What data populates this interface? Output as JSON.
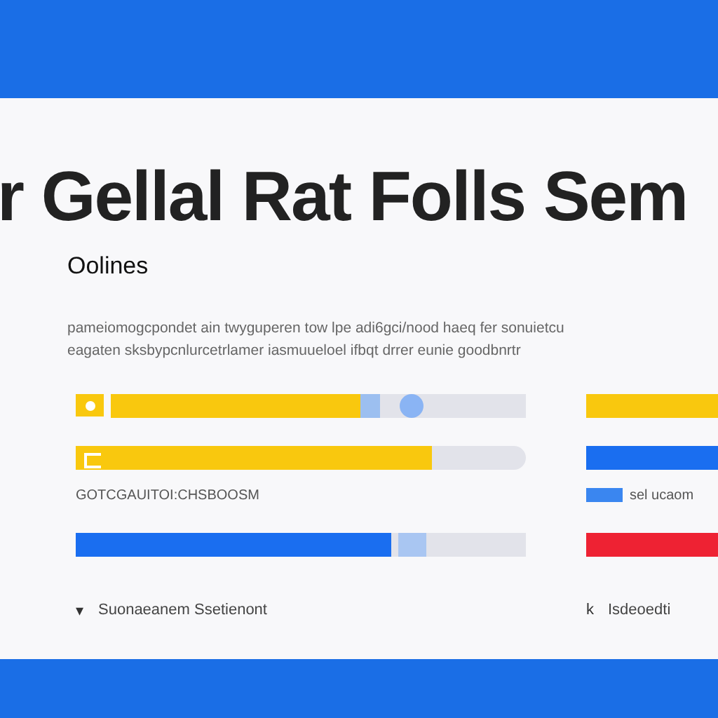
{
  "heading": "r Gellal Rat Folls Sem",
  "subtitle": "Oolines",
  "description": [
    "pameiomogcpondet ain twyguperen tow lpe adi6gci/nood haeq fer sonuietcu",
    "eagaten sksbypcnlurcetrlamer iasmuueloel ifbqt drrer eunie goodbnrtr"
  ],
  "left": [
    {
      "kind": "slider",
      "color": "#f9c80e",
      "level": 0.6
    },
    {
      "kind": "bar",
      "color": "#f9c80e",
      "level": 0.79
    },
    {
      "kind": "label",
      "text": "GOTCGAUITOI:CHSBOOSM"
    },
    {
      "kind": "split",
      "color": "#1a6ef0",
      "level": 0.7
    },
    {
      "kind": "caption",
      "caret": "▾",
      "text": "Suonaeanem Ssetienont"
    }
  ],
  "right": [
    {
      "kind": "bar",
      "color": "#f9c80e"
    },
    {
      "kind": "bar",
      "color": "#1a6ef0"
    },
    {
      "kind": "label",
      "text": "sel ucaom"
    },
    {
      "kind": "bar",
      "color": "#ee2233"
    },
    {
      "kind": "caption",
      "caret": "k",
      "text": "Isdeoedti"
    }
  ]
}
